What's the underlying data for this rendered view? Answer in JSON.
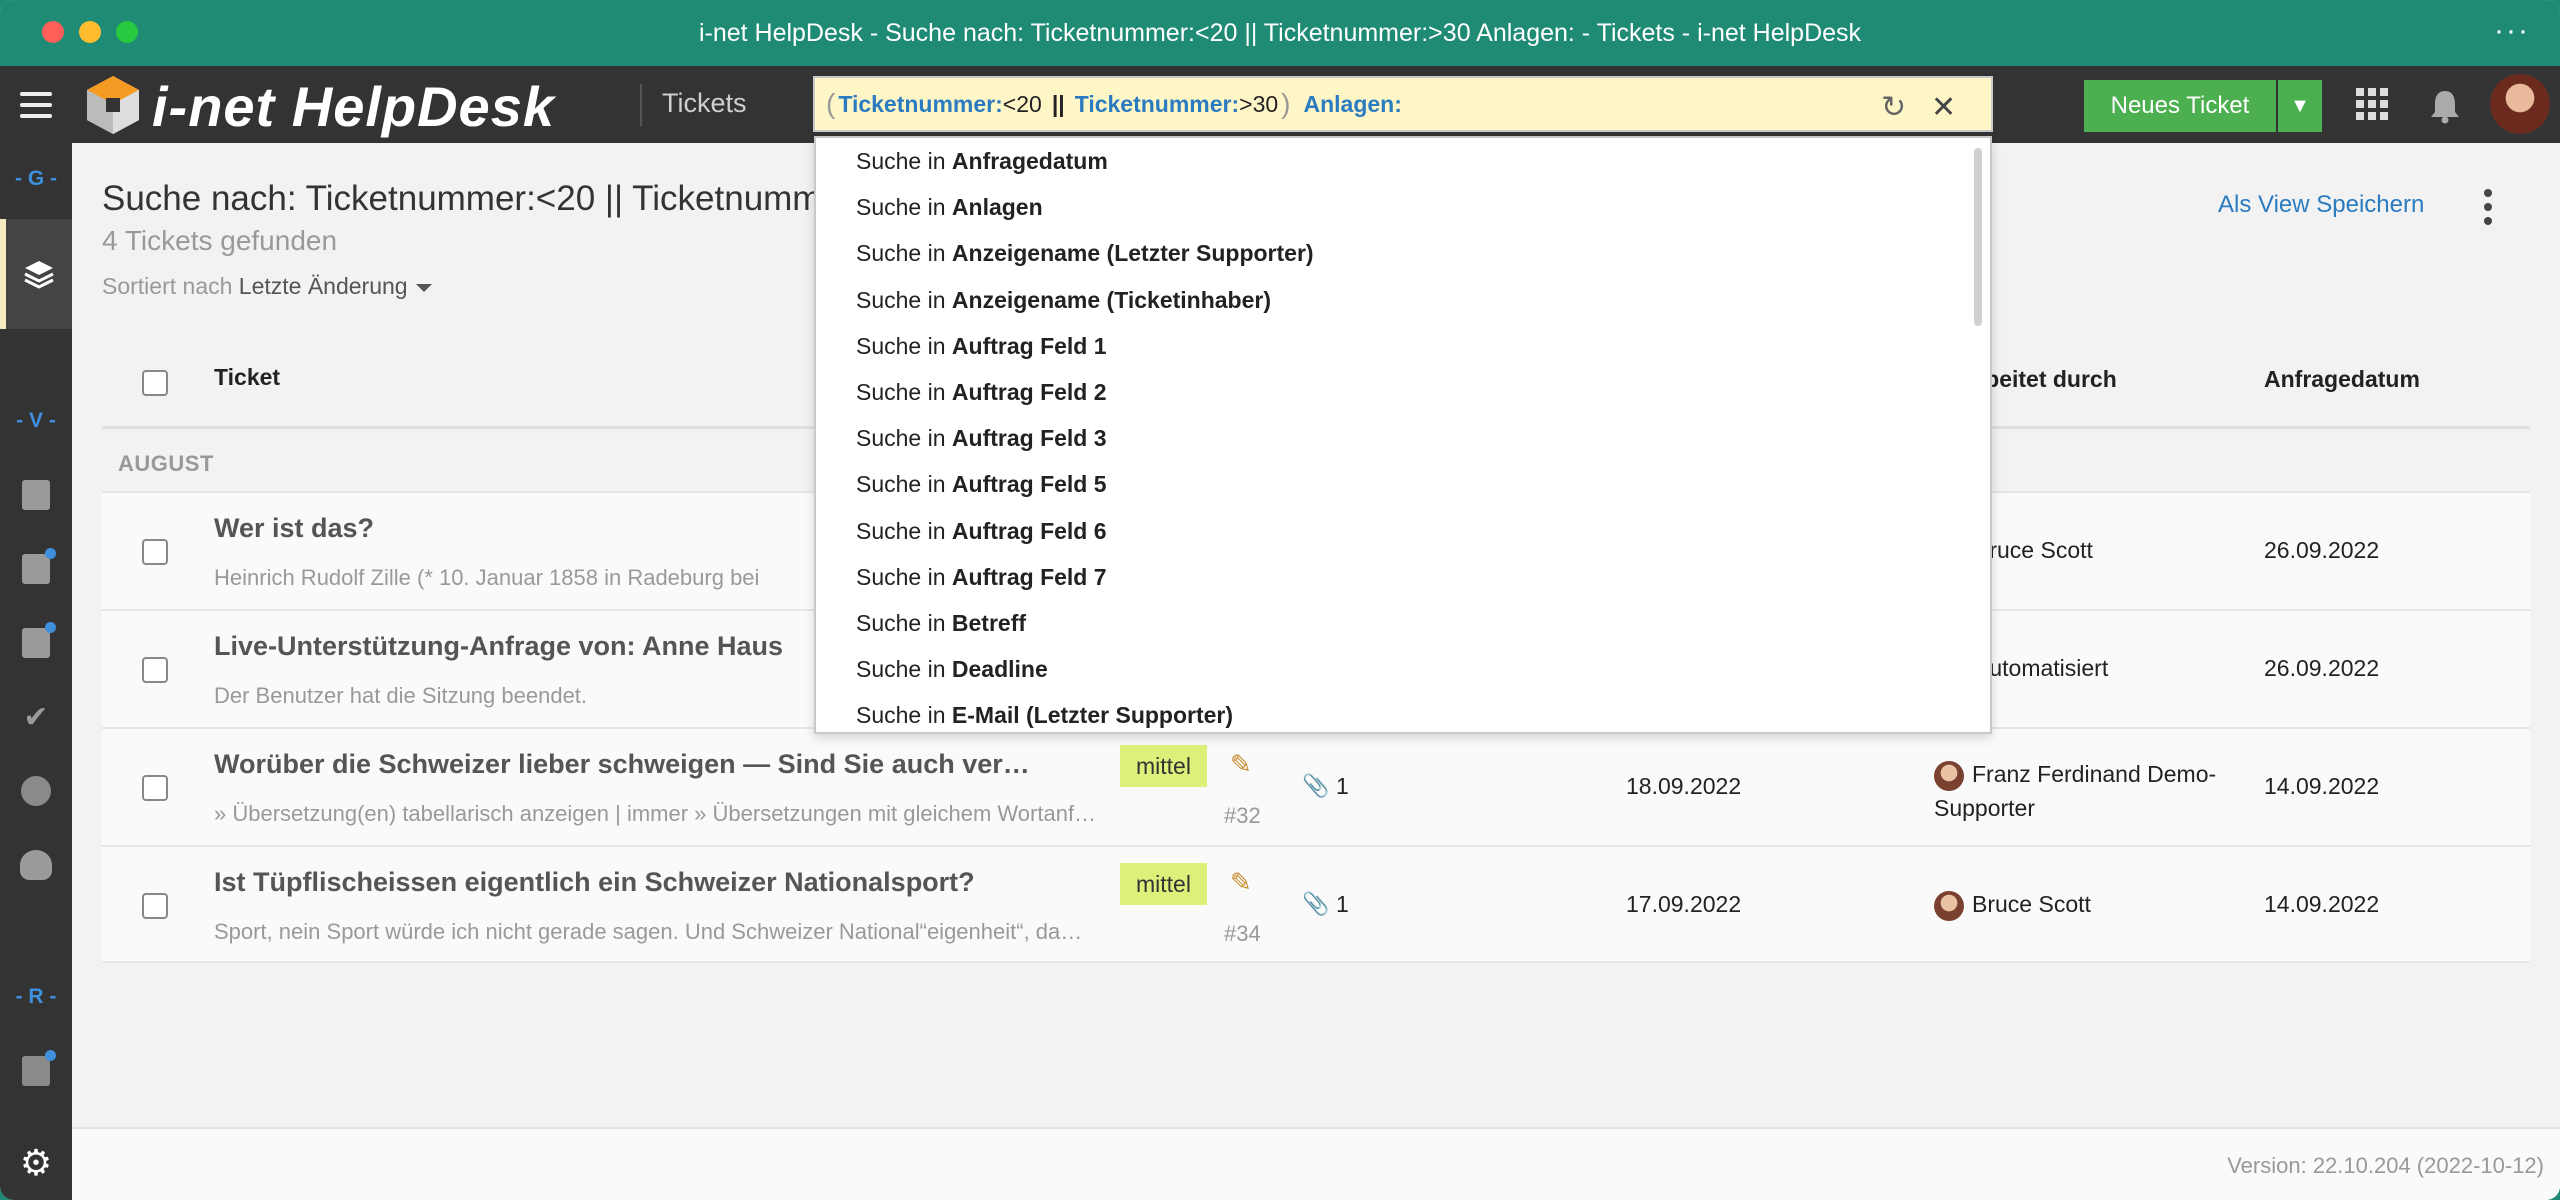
{
  "window": {
    "title": "i-net HelpDesk - Suche nach: Ticketnummer:<20 || Ticketnummer:>30 Anlagen: - Tickets - i-net HelpDesk"
  },
  "topnav": {
    "brand": "i-net HelpDesk",
    "section": "Tickets",
    "new_ticket_label": "Neues Ticket"
  },
  "search": {
    "field1": "Ticketnummer:",
    "value1": "<20",
    "operator": "||",
    "field2": "Ticketnummer:",
    "value2": ">30",
    "field3": "Anlagen:"
  },
  "sidebar": {
    "groups": [
      "- G -",
      "- V -",
      "- R -"
    ]
  },
  "main": {
    "title": "Suche nach: Ticketnummer:<20 || Ticketnummer:>30 Anlagen:",
    "found": "4 Tickets gefunden",
    "sort_prefix": "Sortiert nach",
    "sort_value": "Letzte Änderung",
    "save_view": "Als View Speichern"
  },
  "table": {
    "columns": {
      "ticket": "Ticket",
      "assigned": "Bearbeitet durch",
      "requestdate": "Anfragedatum"
    },
    "group_label": "AUGUST",
    "rows": [
      {
        "title": "Wer ist das?",
        "subtitle": "Heinrich Rudolf Zille (* 10. Januar 1858 in Radeburg bei",
        "person": "Bruce Scott",
        "date2": "26.09.2022"
      },
      {
        "title": "Live-Unterstützung-Anfrage von: Anne Haus",
        "subtitle": "Der Benutzer hat die Sitzung beendet.",
        "person": "Automatisiert",
        "date2": "26.09.2022"
      },
      {
        "title": "Worüber die Schweizer lieber schweigen — Sind Sie auch ver…",
        "subtitle": "» Übersetzung(en) tabellarisch anzeigen | immer » Übersetzungen mit gleichem Wortanf…",
        "priority": "mittel",
        "number": "#32",
        "attachments": "1",
        "date1": "18.09.2022",
        "person": "Franz Ferdinand Demo-",
        "person2": "Supporter",
        "date2": "14.09.2022"
      },
      {
        "title": "Ist Tüpflischeissen eigentlich ein Schweizer Nationalsport?",
        "subtitle": "Sport, nein Sport würde ich nicht gerade sagen. Und Schweizer National“eigenheit“, da…",
        "priority": "mittel",
        "number": "#34",
        "attachments": "1",
        "date1": "17.09.2022",
        "person": "Bruce Scott",
        "date2": "14.09.2022"
      }
    ]
  },
  "dropdown": {
    "prefix": "Suche in",
    "items": [
      "Anfragedatum",
      "Anlagen",
      "Anzeigename (Letzter Supporter)",
      "Anzeigename (Ticketinhaber)",
      "Auftrag Feld 1",
      "Auftrag Feld 2",
      "Auftrag Feld 3",
      "Auftrag Feld 5",
      "Auftrag Feld 6",
      "Auftrag Feld 7",
      "Betreff",
      "Deadline",
      "E-Mail (Letzter Supporter)"
    ]
  },
  "footer": {
    "version": "Version: 22.10.204 (2022-10-12)"
  },
  "icons": {
    "menu": "hamburger-icon",
    "refresh": "refresh-icon",
    "clear": "close-icon",
    "apps": "apps-grid-icon",
    "notifications": "bell-icon",
    "settings": "gear-icon",
    "attachment": "paperclip-icon",
    "edit": "pencil-icon"
  },
  "colors": {
    "titlebar": "#1f8b74",
    "accent_blue": "#2a7bc0",
    "primary_green": "#4caf50",
    "priority_bg": "#dff07a",
    "search_bg": "#fff6c8"
  }
}
